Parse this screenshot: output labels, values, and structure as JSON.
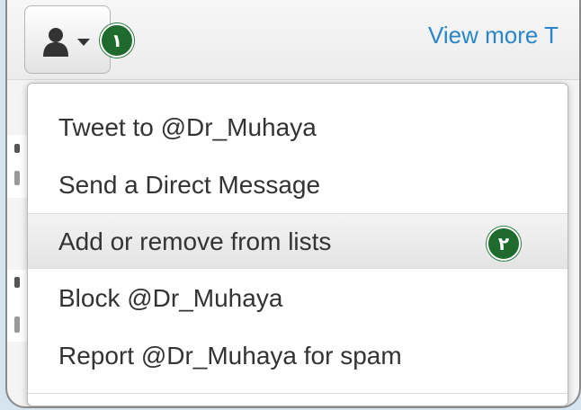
{
  "header": {
    "profile_menu_icon": "person-icon",
    "dropdown_icon": "caret-down-icon",
    "badge_1": "١",
    "view_more_label": "View more T"
  },
  "menu": {
    "items": [
      {
        "label": "Tweet to @Dr_Muhaya"
      },
      {
        "label": "Send a Direct Message"
      },
      {
        "label": "Add or remove from lists"
      },
      {
        "label": "Block @Dr_Muhaya"
      },
      {
        "label": "Report @Dr_Muhaya for spam"
      }
    ],
    "badge_2": "٢"
  },
  "colors": {
    "link": "#2a86c8",
    "badge": "#1f6b2e",
    "text": "#333333"
  }
}
